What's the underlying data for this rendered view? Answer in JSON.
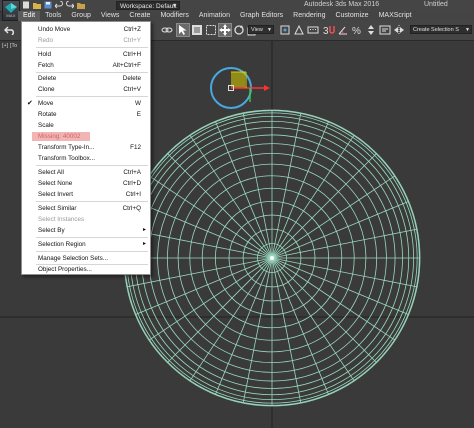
{
  "window": {
    "app_title": "Autodesk 3ds Max 2016",
    "file_title": "Untitled",
    "workspace_label": "Workspace: Default",
    "logo_text": "MAX"
  },
  "menubar": {
    "items": [
      {
        "label": "Edit"
      },
      {
        "label": "Tools"
      },
      {
        "label": "Group"
      },
      {
        "label": "Views"
      },
      {
        "label": "Create"
      },
      {
        "label": "Modifiers"
      },
      {
        "label": "Animation"
      },
      {
        "label": "Graph Editors"
      },
      {
        "label": "Rendering"
      },
      {
        "label": "Customize"
      },
      {
        "label": "MAXScript"
      }
    ]
  },
  "toolbar": {
    "ref_coord": "View",
    "selection_set": "Create Selection S"
  },
  "viewport": {
    "label": "[+] [To"
  },
  "edit_menu": {
    "items": [
      {
        "label": "Undo Move",
        "shortcut": "Ctrl+Z"
      },
      {
        "label": "Redo",
        "shortcut": "Ctrl+Y",
        "disabled": true
      },
      {
        "label": "Hold",
        "shortcut": "Ctrl+H"
      },
      {
        "label": "Fetch",
        "shortcut": "Alt+Ctrl+F"
      },
      {
        "label": "Delete",
        "shortcut": "Delete"
      },
      {
        "label": "Clone",
        "shortcut": "Ctrl+V"
      },
      {
        "label": "Move",
        "shortcut": "W",
        "checked": true
      },
      {
        "label": "Rotate",
        "shortcut": "E"
      },
      {
        "label": "Scale",
        "shortcut": ""
      },
      {
        "label": "Missing: 40002",
        "shortcut": "",
        "missing": true
      },
      {
        "label": "Transform Type-In...",
        "shortcut": "F12"
      },
      {
        "label": "Transform Toolbox...",
        "shortcut": ""
      },
      {
        "label": "Select All",
        "shortcut": "Ctrl+A"
      },
      {
        "label": "Select None",
        "shortcut": "Ctrl+D"
      },
      {
        "label": "Select Invert",
        "shortcut": "Ctrl+I"
      },
      {
        "label": "Select Similar",
        "shortcut": "Ctrl+Q"
      },
      {
        "label": "Select Instances",
        "shortcut": "",
        "disabled": true
      },
      {
        "label": "Select By",
        "shortcut": "",
        "submenu": true
      },
      {
        "label": "Selection Region",
        "shortcut": "",
        "submenu": true
      },
      {
        "label": "Manage Selection Sets...",
        "shortcut": ""
      },
      {
        "label": "Object Properties...",
        "shortcut": ""
      }
    ]
  },
  "colors": {
    "wireframe": "#9ad9c0",
    "gizmo_circle": "#4aa8e0",
    "gizmo_x": "#ff3030",
    "gizmo_y": "#38d038",
    "gizmo_plane": "#d8d000",
    "missing_highlight": "#f2b5b5"
  }
}
